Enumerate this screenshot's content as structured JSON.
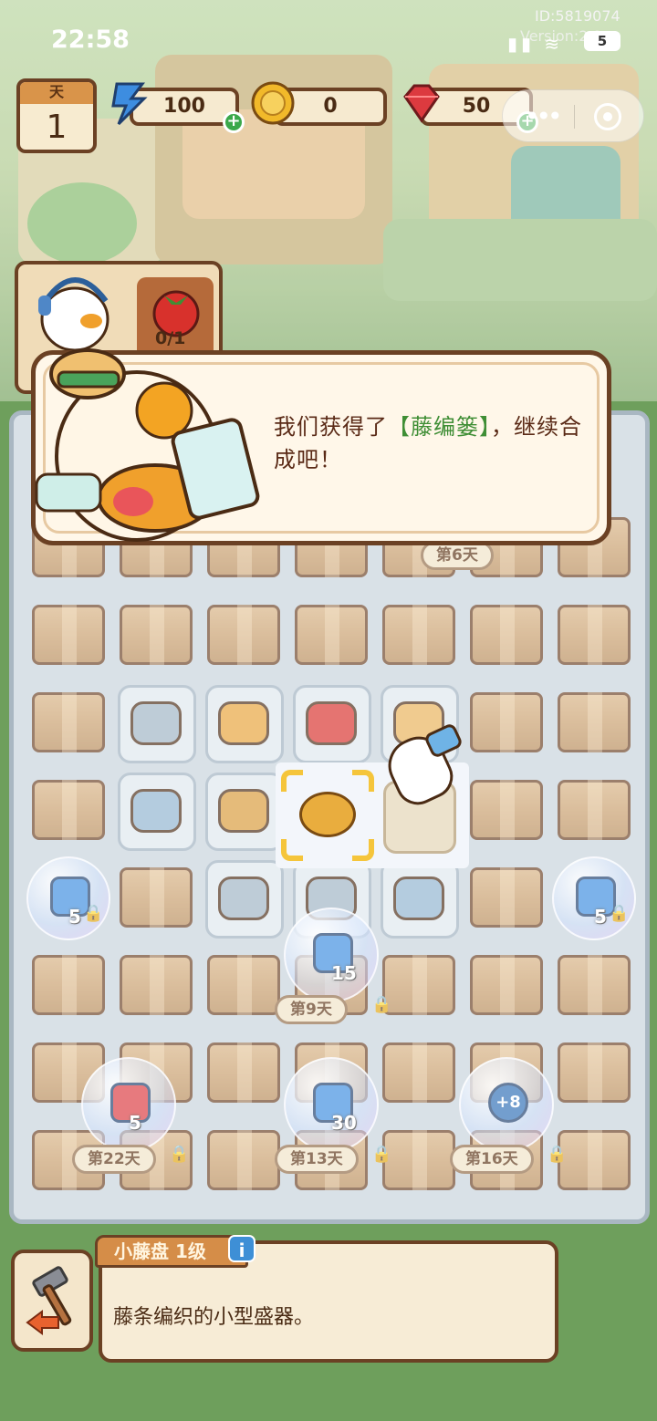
{
  "status_bar": {
    "time": "22:58",
    "id_label": "ID:5819074",
    "version_label": "Version:2.9",
    "battery": "5"
  },
  "hud": {
    "day_label": "天",
    "day_value": "1",
    "energy": "100",
    "coins": "0",
    "gems": "50"
  },
  "order": {
    "progress": "0/1",
    "item_icon": "tomato-icon"
  },
  "dialog": {
    "text_before": "我们获得了",
    "item_name": "【藤编篓】",
    "text_after": "，继续合成吧！"
  },
  "board": {
    "bubbles": [
      {
        "icon": "energy-icon",
        "amount": "5"
      },
      {
        "icon": "energy-icon",
        "amount": "5"
      },
      {
        "icon": "energy-icon",
        "amount": "15",
        "unlock": "第9天"
      },
      {
        "icon": "gem-icon",
        "amount": "5",
        "unlock": "第22天"
      },
      {
        "icon": "energy-icon",
        "amount": "30",
        "unlock": "第13天"
      },
      {
        "icon": "plus-eight-icon",
        "amount": "+8",
        "unlock": "第16天"
      }
    ],
    "top_unlock_left": "天",
    "top_unlock_right": "第6天"
  },
  "item_info": {
    "name": "小藤盘 1级",
    "info_button": "i",
    "description": "藤条编织的小型盛器。"
  },
  "colors": {
    "frame_brown": "#6b4124",
    "item_name_green": "#3f8e35",
    "dialog_text": "#5a2a16"
  }
}
